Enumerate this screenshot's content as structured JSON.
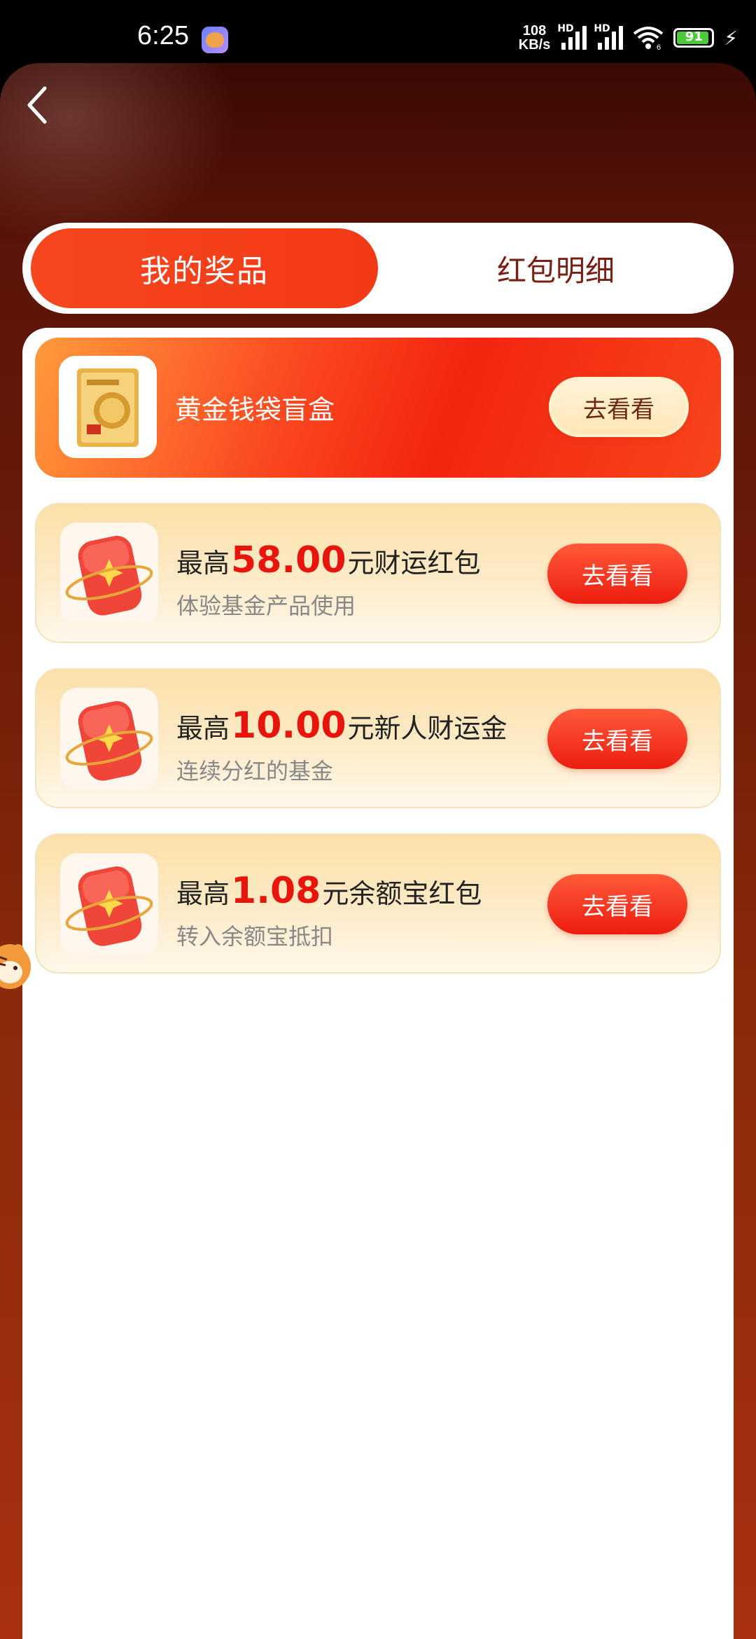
{
  "status_bar": {
    "time": "6:25",
    "net_speed_value": "108",
    "net_speed_unit": "KB/s",
    "sim1_label": "HD",
    "sim2_label": "HD",
    "wifi_sub": "6",
    "battery_level": "91",
    "battery_color": "#4ccb3a"
  },
  "tabs": [
    {
      "label": "我的奖品",
      "active": true
    },
    {
      "label": "红包明细",
      "active": false
    }
  ],
  "prizes": [
    {
      "title": "黄金钱袋盲盒",
      "subtitle": "",
      "button": "去看看",
      "icon": "gold-box-icon"
    },
    {
      "prefix": "最高",
      "amount": "58.00",
      "suffix": "元财运红包",
      "subtitle": "体验基金产品使用",
      "button": "去看看",
      "icon": "red-envelope-icon"
    },
    {
      "prefix": "最高",
      "amount": "10.00",
      "suffix": "元新人财运金",
      "subtitle": "连续分红的基金",
      "button": "去看看",
      "icon": "red-envelope-icon"
    },
    {
      "prefix": "最高",
      "amount": "1.08",
      "suffix": "元余额宝红包",
      "subtitle": "转入余额宝抵扣",
      "button": "去看看",
      "icon": "red-envelope-icon"
    }
  ],
  "colors": {
    "accent": "#f23a16",
    "amount": "#e8150d",
    "tab_inactive_text": "#7a1f12"
  }
}
